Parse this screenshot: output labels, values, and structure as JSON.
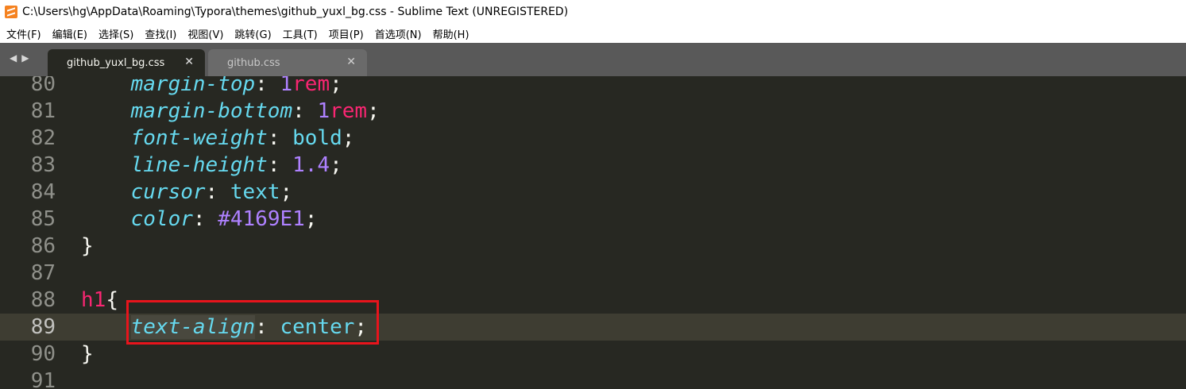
{
  "window": {
    "title": "C:\\Users\\hg\\AppData\\Roaming\\Typora\\themes\\github_yuxl_bg.css - Sublime Text (UNREGISTERED)"
  },
  "menu": [
    "文件(F)",
    "编辑(E)",
    "选择(S)",
    "查找(I)",
    "视图(V)",
    "跳转(G)",
    "工具(T)",
    "项目(P)",
    "首选项(N)",
    "帮助(H)"
  ],
  "tabs": [
    {
      "label": "github_yuxl_bg.css",
      "active": true
    },
    {
      "label": "github.css",
      "active": false
    }
  ],
  "icons": {
    "nav_back": "◀",
    "nav_forward": "▶",
    "close": "✕"
  },
  "colors": {
    "editor_bg": "#272822",
    "property": "#66d9ef",
    "number": "#ae81ff",
    "unit": "#f92672",
    "annotation": "#e8141c"
  },
  "code_lines": [
    {
      "num": "80",
      "tokens": [
        [
          "    ",
          ""
        ],
        [
          "margin-top",
          "prop"
        ],
        [
          ": ",
          "punct"
        ],
        [
          "1",
          "num"
        ],
        [
          "rem",
          "unit"
        ],
        [
          ";",
          "punct"
        ]
      ]
    },
    {
      "num": "81",
      "tokens": [
        [
          "    ",
          ""
        ],
        [
          "margin-bottom",
          "prop"
        ],
        [
          ": ",
          "punct"
        ],
        [
          "1",
          "num"
        ],
        [
          "rem",
          "unit"
        ],
        [
          ";",
          "punct"
        ]
      ]
    },
    {
      "num": "82",
      "tokens": [
        [
          "    ",
          ""
        ],
        [
          "font-weight",
          "prop"
        ],
        [
          ": ",
          "punct"
        ],
        [
          "bold",
          "val"
        ],
        [
          ";",
          "punct"
        ]
      ]
    },
    {
      "num": "83",
      "tokens": [
        [
          "    ",
          ""
        ],
        [
          "line-height",
          "prop"
        ],
        [
          ": ",
          "punct"
        ],
        [
          "1.4",
          "num"
        ],
        [
          ";",
          "punct"
        ]
      ]
    },
    {
      "num": "84",
      "tokens": [
        [
          "    ",
          ""
        ],
        [
          "cursor",
          "prop"
        ],
        [
          ": ",
          "punct"
        ],
        [
          "text",
          "val"
        ],
        [
          ";",
          "punct"
        ]
      ]
    },
    {
      "num": "85",
      "tokens": [
        [
          "    ",
          ""
        ],
        [
          "color",
          "prop"
        ],
        [
          ": ",
          "punct"
        ],
        [
          "#4169E1",
          "num"
        ],
        [
          ";",
          "punct"
        ]
      ]
    },
    {
      "num": "86",
      "tokens": [
        [
          "}",
          "punct"
        ]
      ]
    },
    {
      "num": "87",
      "tokens": []
    },
    {
      "num": "88",
      "tokens": [
        [
          "h1",
          "sel"
        ],
        [
          "{",
          "punct"
        ]
      ]
    },
    {
      "num": "89",
      "current": true,
      "tokens": [
        [
          "    ",
          ""
        ],
        [
          "text-align",
          "prop hl"
        ],
        [
          ": ",
          "punct"
        ],
        [
          "center",
          "val"
        ],
        [
          ";",
          "punct"
        ]
      ]
    },
    {
      "num": "90",
      "tokens": [
        [
          "}",
          "punct"
        ]
      ]
    },
    {
      "num": "91",
      "tokens": []
    }
  ]
}
